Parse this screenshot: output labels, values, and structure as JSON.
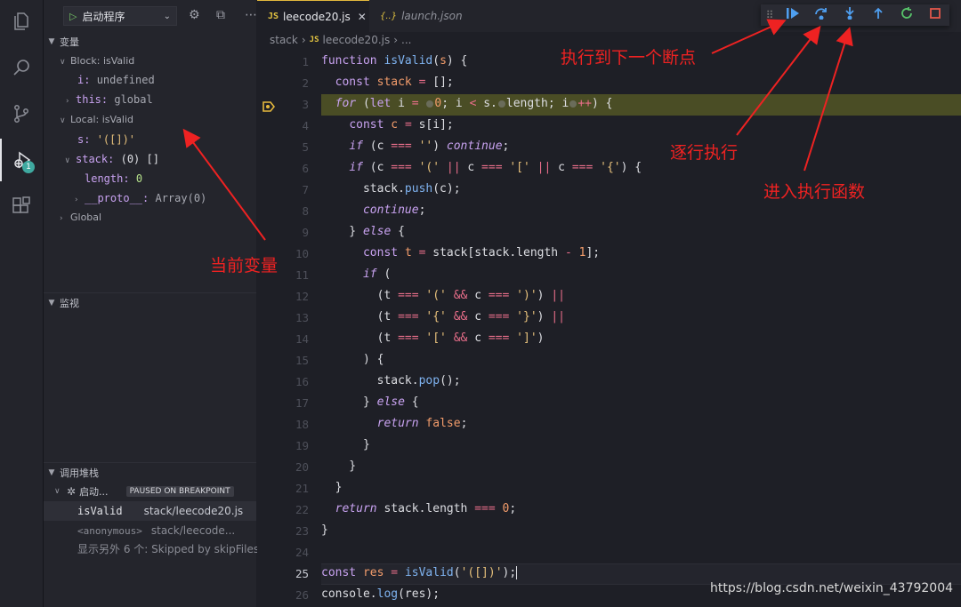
{
  "debug": {
    "config_label": "启动程序",
    "sections": {
      "variables": "变量",
      "watch": "监视",
      "callstack": "调用堆栈"
    },
    "scopes": {
      "block": "Block: isValid",
      "local": "Local: isValid",
      "global": "Global"
    },
    "vars": {
      "i_name": "i:",
      "i_val": "undefined",
      "this_name": "this:",
      "this_val": "global",
      "s_name": "s:",
      "s_val": "'([])'",
      "stack_name": "stack:",
      "stack_val": "(0) []",
      "length_name": "length:",
      "length_val": "0",
      "proto_name": "__proto__:",
      "proto_val": "Array(0)"
    },
    "callstack": {
      "session": "启动...",
      "paused": "PAUSED ON BREAKPOINT",
      "frame1_fn": "isValid",
      "frame1_file": "stack/leecode20.js",
      "frame2_fn": "<anonymous>",
      "frame2_file": "stack/leecode...",
      "more": "显示另外 6 个: Skipped by skipFiles"
    },
    "badge": "1"
  },
  "editor": {
    "tab_active": "leecode20.js",
    "tab_other": "launch.json",
    "tab_js_icon": "JS",
    "tab_json_icon": "{..}",
    "breadcrumb": [
      "stack",
      "leecode20.js",
      "..."
    ]
  },
  "line_numbers": [
    "1",
    "2",
    "3",
    "4",
    "5",
    "6",
    "7",
    "8",
    "9",
    "10",
    "11",
    "12",
    "13",
    "14",
    "15",
    "16",
    "17",
    "18",
    "19",
    "20",
    "21",
    "22",
    "23",
    "24",
    "25",
    "26"
  ],
  "annotations": {
    "current_vars": "当前变量",
    "run_to_next": "执行到下一个断点",
    "step_over": "逐行执行",
    "step_into": "进入执行函数"
  },
  "watermark": "https://blog.csdn.net/weixin_43792004",
  "icons": {
    "activity": [
      "files-icon",
      "search-icon",
      "source-control-icon",
      "debug-icon",
      "extensions-icon"
    ],
    "toolbar": [
      "continue-icon",
      "step-over-icon",
      "step-into-icon",
      "step-out-icon",
      "restart-icon",
      "stop-icon"
    ]
  },
  "colors": {
    "annotation": "#ee2222",
    "breakpoint_line": "#4a4d25"
  }
}
